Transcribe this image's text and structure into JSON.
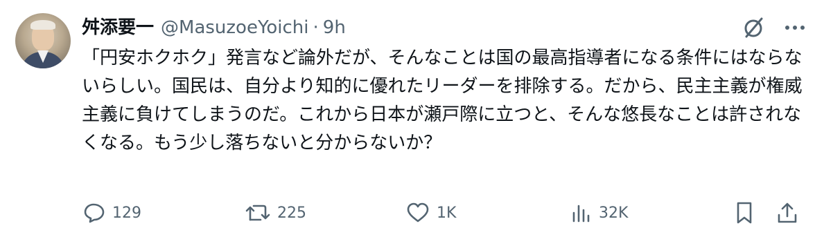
{
  "author": {
    "name": "舛添要一",
    "handle": "@MasuzoeYoichi",
    "separator": "·",
    "time": "9h"
  },
  "post": {
    "text": "「円安ホクホク」発言など論外だが、そんなことは国の最高指導者になる条件にはならないらしい。国民は、自分より知的に優れたリーダーを排除する。だから、民主主義が権威主義に負けてしまうのだ。これから日本が瀬戸際に立つと、そんな悠長なことは許されなくなる。もう少し落ちないと分からないか？"
  },
  "actions": {
    "replies": "129",
    "reposts": "225",
    "likes": "1K",
    "views": "32K"
  },
  "icons": {
    "grok": "grok-slash-icon",
    "more": "more-horizontal-icon",
    "reply": "speech-bubble-icon",
    "repost": "repost-arrows-icon",
    "like": "heart-icon",
    "views": "bar-chart-icon",
    "bookmark": "bookmark-icon",
    "share": "share-upload-icon"
  },
  "colors": {
    "text": "#0f1419",
    "secondary": "#536471",
    "background": "#ffffff"
  }
}
